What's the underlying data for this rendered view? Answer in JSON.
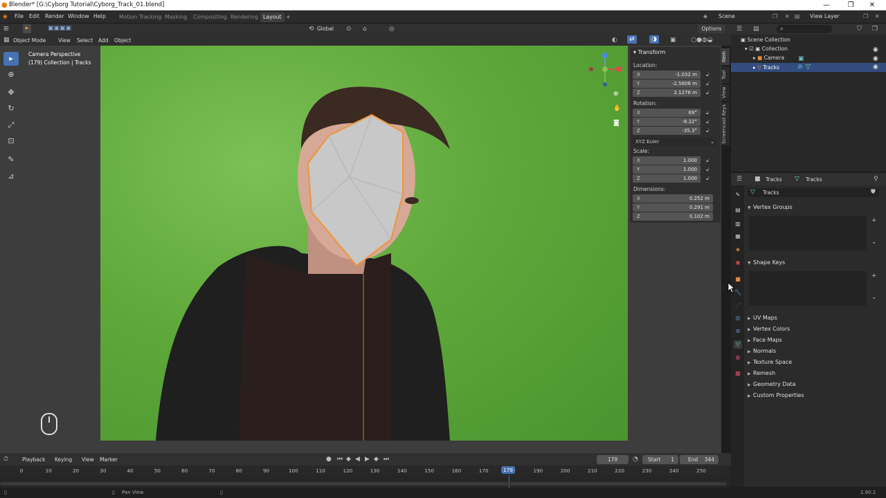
{
  "window": {
    "title": "Blender* [G:\\Cyborg Tutorial\\Cyborg_Track_01.blend]",
    "minimize": "—",
    "maximize": "❐",
    "close": "✕"
  },
  "menu": {
    "items": [
      "File",
      "Edit",
      "Render",
      "Window",
      "Help"
    ],
    "workspaces": [
      "Motion Tracking",
      "Masking",
      "Compositing",
      "Rendering",
      "Layout"
    ],
    "active_workspace": "Layout",
    "add_workspace": "+"
  },
  "scene": {
    "name": "Scene",
    "view_layer": "View Layer"
  },
  "viewport_header": {
    "mode": "Object Mode",
    "menus": [
      "View",
      "Select",
      "Add",
      "Object"
    ],
    "orientation": "Global",
    "options": "Options"
  },
  "viewport": {
    "camera_label": "Camera Perspective",
    "collection_label": "(179) Collection | Tracks"
  },
  "npanel": {
    "tabs": [
      "Item",
      "Tool",
      "View",
      "Screencast Keys"
    ],
    "title": "Transform",
    "location_label": "Location:",
    "location": [
      {
        "axis": "X",
        "value": "-1.032 m"
      },
      {
        "axis": "Y",
        "value": "-2.5608 m"
      },
      {
        "axis": "Z",
        "value": "2.1276 m"
      }
    ],
    "rotation_label": "Rotation:",
    "rotation": [
      {
        "axis": "X",
        "value": "69°"
      },
      {
        "axis": "Y",
        "value": "-8.22°"
      },
      {
        "axis": "Z",
        "value": "-35.3°"
      }
    ],
    "rotation_mode": "XYZ Euler",
    "scale_label": "Scale:",
    "scale": [
      {
        "axis": "X",
        "value": "1.000"
      },
      {
        "axis": "Y",
        "value": "1.000"
      },
      {
        "axis": "Z",
        "value": "1.000"
      }
    ],
    "dimensions_label": "Dimensions:",
    "dimensions": [
      {
        "axis": "X",
        "value": "0.252 m"
      },
      {
        "axis": "Y",
        "value": "0.291 m"
      },
      {
        "axis": "Z",
        "value": "0.102 m"
      }
    ]
  },
  "outliner": {
    "root": "Scene Collection",
    "collection": "Collection",
    "items": [
      "Camera",
      "Tracks"
    ],
    "selected": "Tracks"
  },
  "properties": {
    "breadcrumb_object": "Tracks",
    "breadcrumb_data": "Tracks",
    "mesh_name": "Tracks",
    "sections_expanded": [
      "Vertex Groups",
      "Shape Keys"
    ],
    "sections_collapsed": [
      "UV Maps",
      "Vertex Colors",
      "Face Maps",
      "Normals",
      "Texture Space",
      "Remesh",
      "Geometry Data",
      "Custom Properties"
    ]
  },
  "timeline": {
    "menus": [
      "Playback",
      "Keying",
      "View",
      "Marker"
    ],
    "current_frame": "179",
    "start_label": "Start",
    "start": "1",
    "end_label": "End",
    "end": "344",
    "ticks": [
      "0",
      "10",
      "20",
      "30",
      "40",
      "50",
      "60",
      "70",
      "80",
      "90",
      "100",
      "110",
      "120",
      "130",
      "140",
      "150",
      "160",
      "170",
      "179",
      "190",
      "200",
      "210",
      "220",
      "230",
      "240",
      "250"
    ]
  },
  "status": {
    "hint": "Pan View",
    "version": "2.90.1"
  },
  "colors": {
    "accent": "#4772b3",
    "selection": "#f0943a",
    "frame_marker": "#4772b3",
    "green_screen": "#5fa83a"
  }
}
